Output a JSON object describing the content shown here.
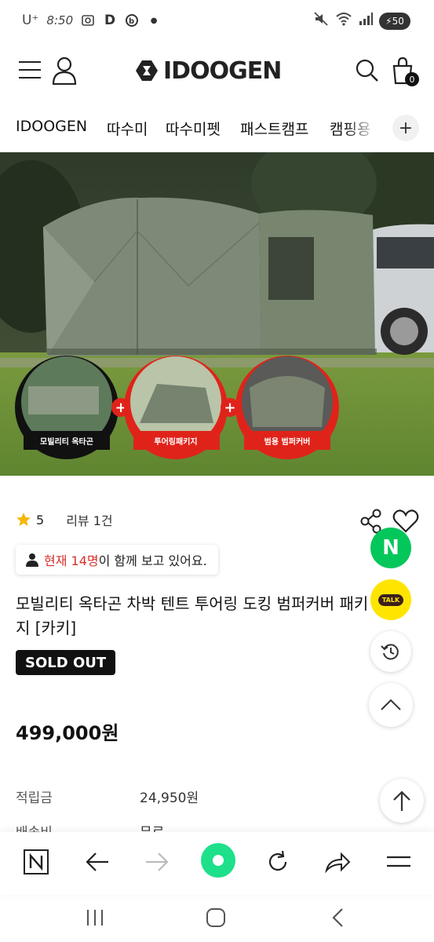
{
  "status_bar": {
    "carrier": "U⁺",
    "time": "8:50",
    "battery": "50",
    "icons": [
      "screenshot-icon",
      "d-app-icon",
      "b-app-icon",
      "dot-icon",
      "mute-icon",
      "wifi-icon",
      "signal-icon",
      "battery-icon"
    ]
  },
  "header": {
    "logo_text": "IDOOGEN",
    "cart_count": "0"
  },
  "category_nav": {
    "items": [
      "IDOOGEN",
      "따수미",
      "따수미펫",
      "패스트캠프",
      "캠핑용"
    ],
    "more_label": "+"
  },
  "hero": {
    "bubbles": [
      {
        "label": "모빌리티 옥타곤",
        "color": "#111111"
      },
      {
        "label": "투어링패키지",
        "color": "#e0231a"
      },
      {
        "label": "범용 범퍼커버",
        "color": "#e0231a"
      }
    ]
  },
  "product": {
    "rating": "5",
    "review_label": "리뷰 1건",
    "viewer_prefix": "현재 14명",
    "viewer_suffix": "이 함께 보고 있어요.",
    "title": "모빌리티 옥타곤 차박 텐트 투어링 도킹 범퍼커버 패키지 [카키]",
    "soldout_label": "SOLD OUT",
    "price": "499,000원",
    "info": [
      {
        "label": "적립금",
        "value": "24,950원"
      },
      {
        "label": "배송비",
        "value": "무료"
      }
    ]
  },
  "floating": {
    "naver_label": "N",
    "talk_label": "TALK"
  },
  "colors": {
    "accent_red": "#d6312b",
    "naver_green": "#03c75a",
    "kakao_yellow": "#fee500",
    "browser_home": "#1ee08a"
  }
}
